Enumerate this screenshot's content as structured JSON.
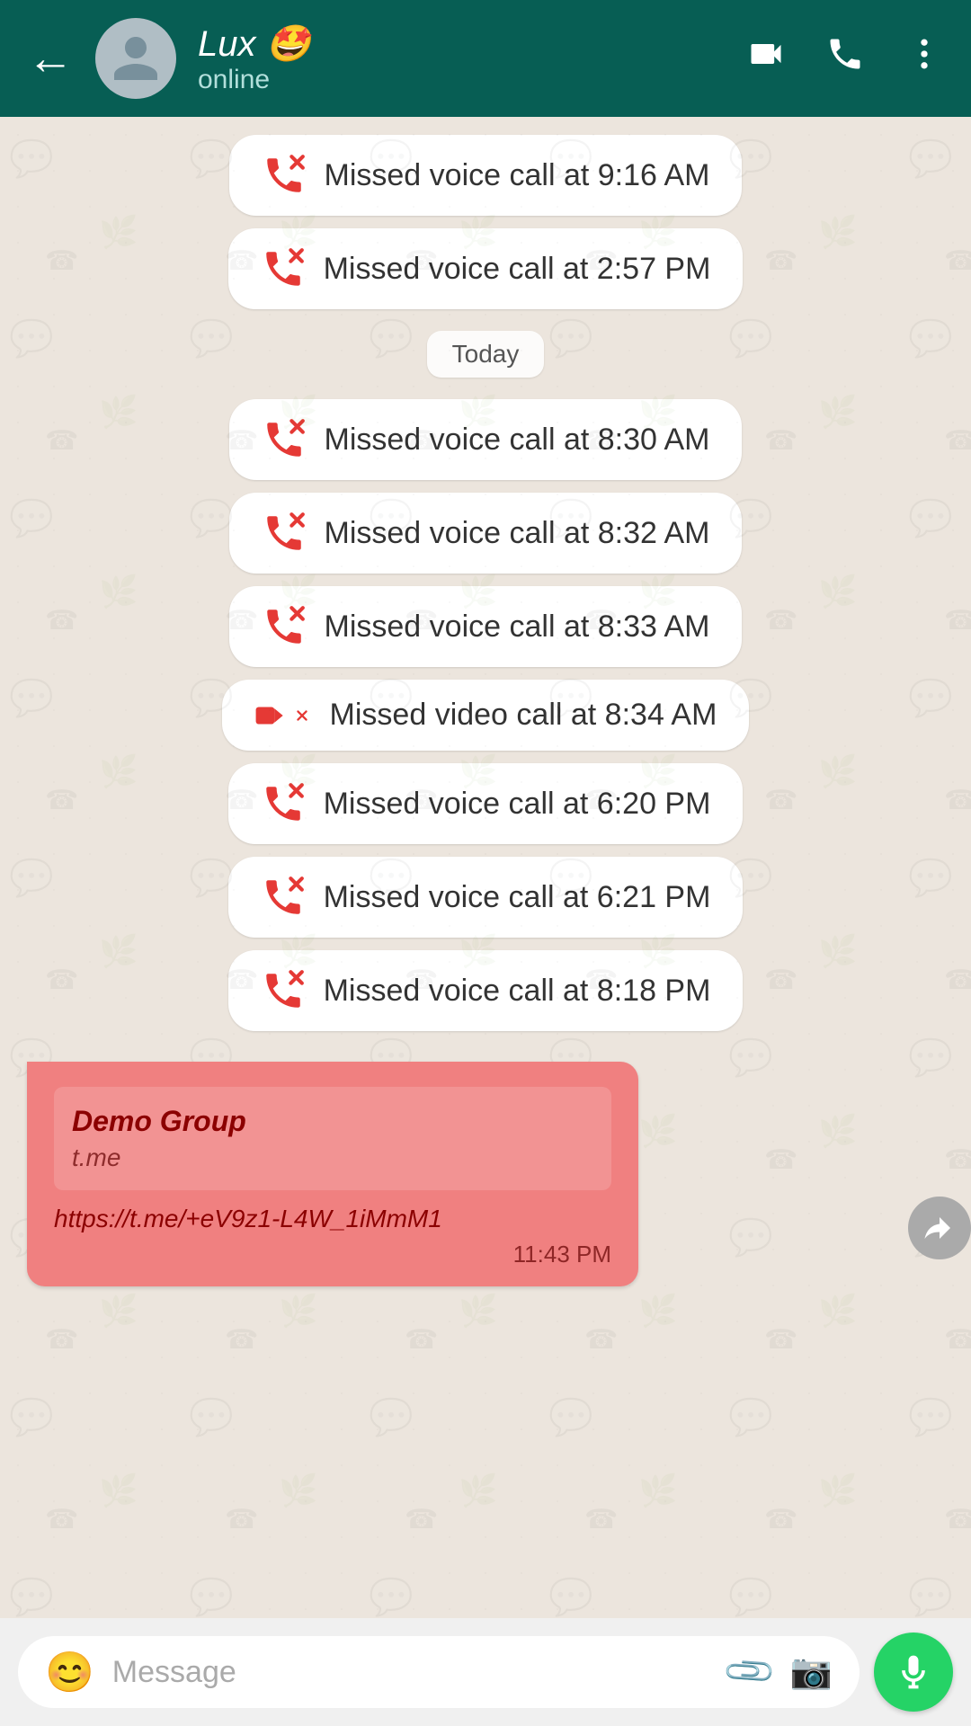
{
  "header": {
    "back_label": "←",
    "name": "Lux 🤩",
    "status": "online",
    "video_call_label": "video-call",
    "voice_call_label": "voice-call",
    "more_label": "more"
  },
  "date_divider": {
    "label": "Today"
  },
  "call_messages": [
    {
      "id": 1,
      "type": "voice",
      "text": "Missed voice call at 9:16 AM"
    },
    {
      "id": 2,
      "type": "voice",
      "text": "Missed voice call at 2:57 PM"
    },
    {
      "id": 3,
      "type": "voice",
      "text": "Missed voice call at 8:30 AM"
    },
    {
      "id": 4,
      "type": "voice",
      "text": "Missed voice call at 8:32 AM"
    },
    {
      "id": 5,
      "type": "voice",
      "text": "Missed voice call at 8:33 AM"
    },
    {
      "id": 6,
      "type": "video",
      "text": "Missed video call at 8:34 AM"
    },
    {
      "id": 7,
      "type": "voice",
      "text": "Missed voice call at 6:20 PM"
    },
    {
      "id": 8,
      "type": "voice",
      "text": "Missed voice call at 6:21 PM"
    },
    {
      "id": 9,
      "type": "voice",
      "text": "Missed voice call at 8:18 PM"
    }
  ],
  "forward_message": {
    "group_name": "Demo Group",
    "tme": "t.me",
    "link": "https://t.me/+eV9z1-L4W_1iMmM1",
    "time": "11:43 PM"
  },
  "input": {
    "placeholder": "Message",
    "mic_label": "🎤"
  }
}
